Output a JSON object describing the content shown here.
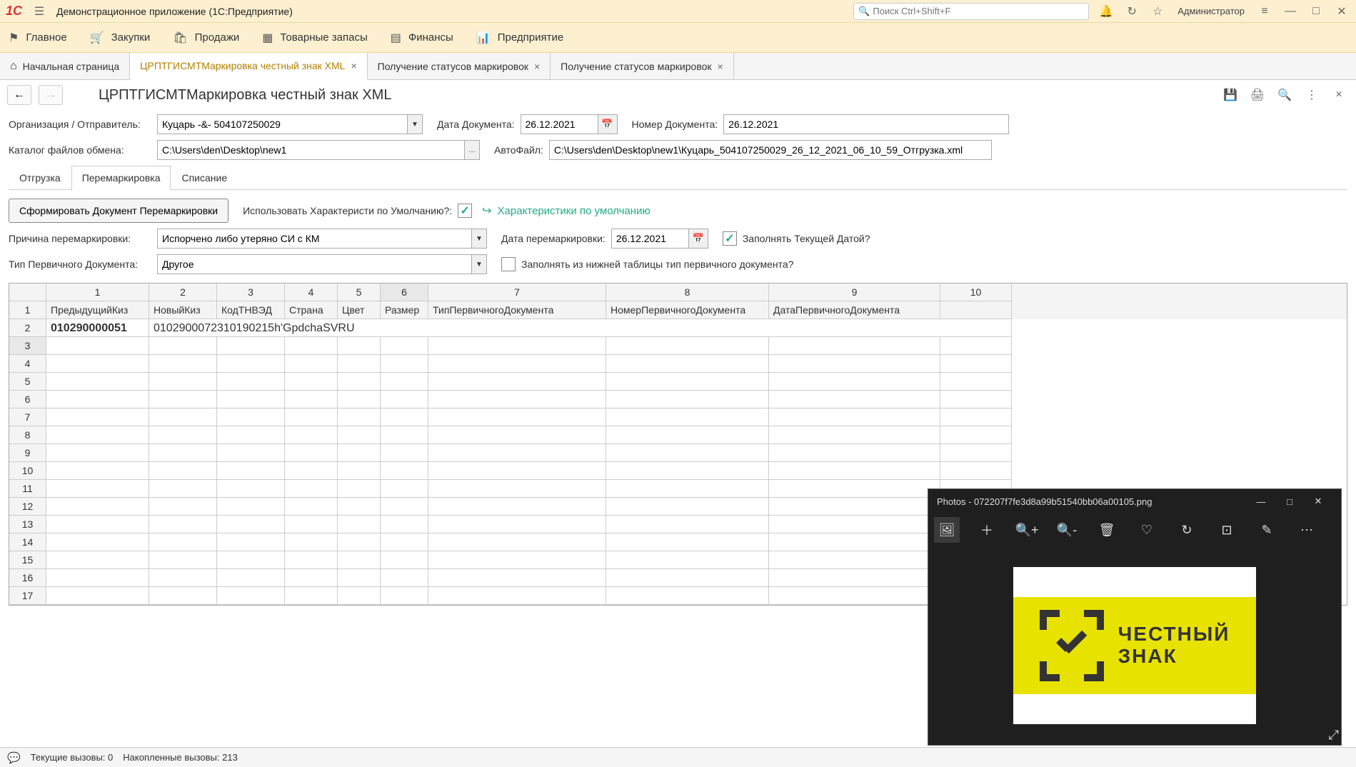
{
  "titlebar": {
    "app_title": "Демонстрационное приложение  (1С:Предприятие)",
    "search_placeholder": "Поиск Ctrl+Shift+F",
    "user": "Администратор"
  },
  "menubar": {
    "items": [
      {
        "label": "Главное"
      },
      {
        "label": "Закупки"
      },
      {
        "label": "Продажи"
      },
      {
        "label": "Товарные запасы"
      },
      {
        "label": "Финансы"
      },
      {
        "label": "Предприятие"
      }
    ]
  },
  "tabs": [
    {
      "label": "Начальная страница",
      "closable": false,
      "home": true
    },
    {
      "label": "ЦРПТГИСМТМаркировка честный знак XML",
      "closable": true,
      "active": true
    },
    {
      "label": "Получение статусов маркировок",
      "closable": true
    },
    {
      "label": "Получение статусов маркировок",
      "closable": true
    }
  ],
  "page": {
    "title": "ЦРПТГИСМТМаркировка честный знак XML"
  },
  "form": {
    "org_label": "Организация / Отправитель:",
    "org_value": "Куцарь -&- 504107250029",
    "doc_date_label": "Дата Документа:",
    "doc_date_value": "26.12.2021",
    "doc_num_label": "Номер Документа:",
    "doc_num_value": "26.12.2021",
    "catalog_label": "Каталог файлов обмена:",
    "catalog_value": "C:\\Users\\den\\Desktop\\new1",
    "autofile_label": "АвтоФайл:",
    "autofile_value": "C:\\Users\\den\\Desktop\\new1\\Куцарь_504107250029_26_12_2021_06_10_59_Отгрузка.xml"
  },
  "subtabs": [
    {
      "label": "Отгрузка"
    },
    {
      "label": "Перемаркировка",
      "active": true
    },
    {
      "label": "Списание"
    }
  ],
  "remark": {
    "gen_btn": "Сформировать Документ Перемаркировки",
    "use_default_label": "Использовать Характеристи по Умолчанию?:",
    "default_link": "Характеристики по умолчанию",
    "reason_label": "Причина перемаркировки:",
    "reason_value": "Испорчено либо утеряно СИ с КМ",
    "remark_date_label": "Дата перемаркировки:",
    "remark_date_value": "26.12.2021",
    "fill_current_date": "Заполнять Текущей Датой?",
    "primary_doc_type_label": "Тип Первичного Документа:",
    "primary_doc_type_value": "Другое",
    "fill_from_table": "Заполнять из нижней таблицы тип первичного документа?"
  },
  "grid": {
    "col_nums": [
      "1",
      "2",
      "3",
      "4",
      "5",
      "6",
      "7",
      "8",
      "9",
      "10"
    ],
    "headers": [
      "ПредыдущийКиз",
      "НовыйКиз",
      "КодТНВЭД",
      "Страна",
      "Цвет",
      "Размер",
      "ТипПервичногоДокумента",
      "НомерПервичногоДокумента",
      "ДатаПервичногоДокумента",
      ""
    ],
    "row1": {
      "col1": "010290000051",
      "col2_merged": "0102900072310190215h'GpdchaSVRU"
    },
    "row_count": 17,
    "selected_row": 3,
    "selected_col": 6
  },
  "statusbar": {
    "current": "Текущие вызовы: 0",
    "accumulated": "Накопленные вызовы: 213"
  },
  "photos": {
    "title": "Photos - 072207f7fe3d8a99b51540bb06a00105.png",
    "logo_text1": "ЧЕСТНЫЙ",
    "logo_text2": "ЗНАК"
  }
}
